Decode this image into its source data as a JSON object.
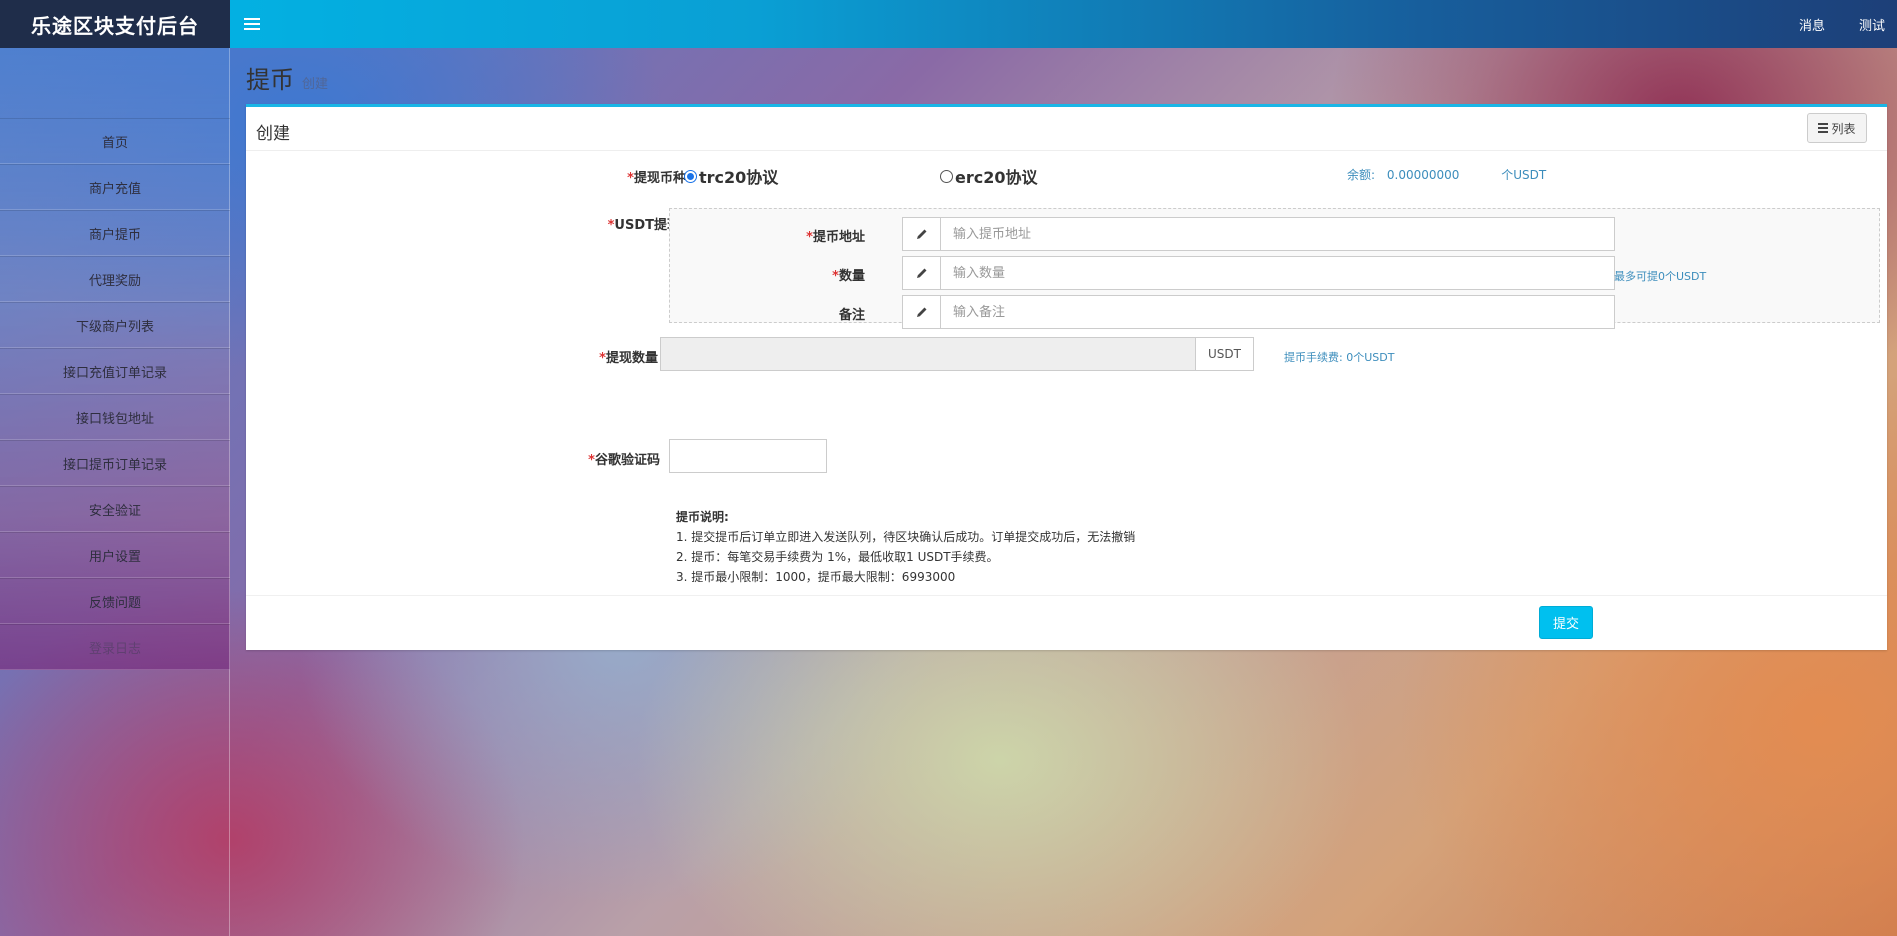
{
  "brand": "乐途区块支付后台",
  "topbar": {
    "links": [
      "消息",
      "测试"
    ]
  },
  "sidebar": {
    "items": [
      "首页",
      "商户充值",
      "商户提币",
      "代理奖励",
      "下级商户列表",
      "接口充值订单记录",
      "接口钱包地址",
      "接口提币订单记录",
      "安全验证",
      "用户设置",
      "反馈问题",
      "登录日志"
    ]
  },
  "page": {
    "title": "提币",
    "subtitle": "创建"
  },
  "panel": {
    "title": "创建",
    "list_button": "列表",
    "coin_type": {
      "label": "提现币种",
      "options": [
        "trc20协议",
        "erc20协议"
      ],
      "selected": "trc20协议"
    },
    "balance": {
      "label": "余额:",
      "value": "0.00000000",
      "unit": "个USDT"
    },
    "usdt_section": {
      "label": "USDT提现",
      "address": {
        "label": "提币地址",
        "placeholder": "输入提币地址"
      },
      "quantity": {
        "label": "数量",
        "placeholder": "输入数量"
      },
      "remark": {
        "label": "备注",
        "placeholder": "输入备注"
      },
      "max_hint": "最多可提0个USDT"
    },
    "withdraw_amount": {
      "label": "提现数量",
      "suffix": "USDT",
      "fee_hint": "提币手续费: 0个USDT"
    },
    "captcha": {
      "label": "谷歌验证码"
    },
    "notes": {
      "title": "提币说明:",
      "lines": [
        "1. 提交提币后订单立即进入发送队列，待区块确认后成功。订单提交成功后，无法撤销",
        "2. 提币：每笔交易手续费为 1%，最低收取1 USDT手续费。",
        "3. 提币最小限制：1000，提币最大限制：6993000"
      ]
    },
    "submit": "提交"
  }
}
